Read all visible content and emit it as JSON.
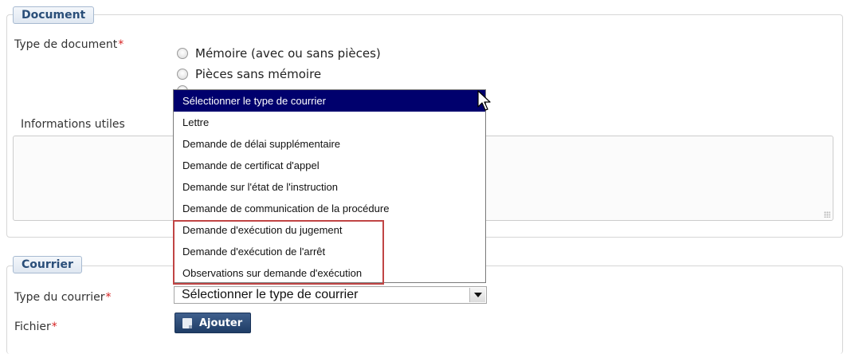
{
  "document_section": {
    "legend": "Document",
    "doc_type_label": "Type de document",
    "required_mark": "*",
    "radio_options": [
      "Mémoire (avec ou sans pièces)",
      "Pièces sans mémoire"
    ],
    "info_label": "Informations utiles"
  },
  "courrier_section": {
    "legend": "Courrier",
    "type_label": "Type du courrier",
    "file_label": "Fichier",
    "required_mark": "*",
    "select_value": "Sélectionner le type de courrier",
    "add_button": "Ajouter"
  },
  "dropdown": {
    "options": [
      "Sélectionner le type de courrier",
      "Lettre",
      "Demande de délai supplémentaire",
      "Demande de certificat d'appel",
      "Demande sur l'état de l'instruction",
      "Demande de communication de la procédure",
      "Demande d'exécution du jugement",
      "Demande d'exécution de l'arrêt",
      "Observations sur demande d'exécution"
    ],
    "selected_index": 0,
    "highlight_color": "#c04545"
  },
  "colors": {
    "accent": "#2a4e79",
    "required": "#d62020",
    "selection": "#00006d"
  }
}
